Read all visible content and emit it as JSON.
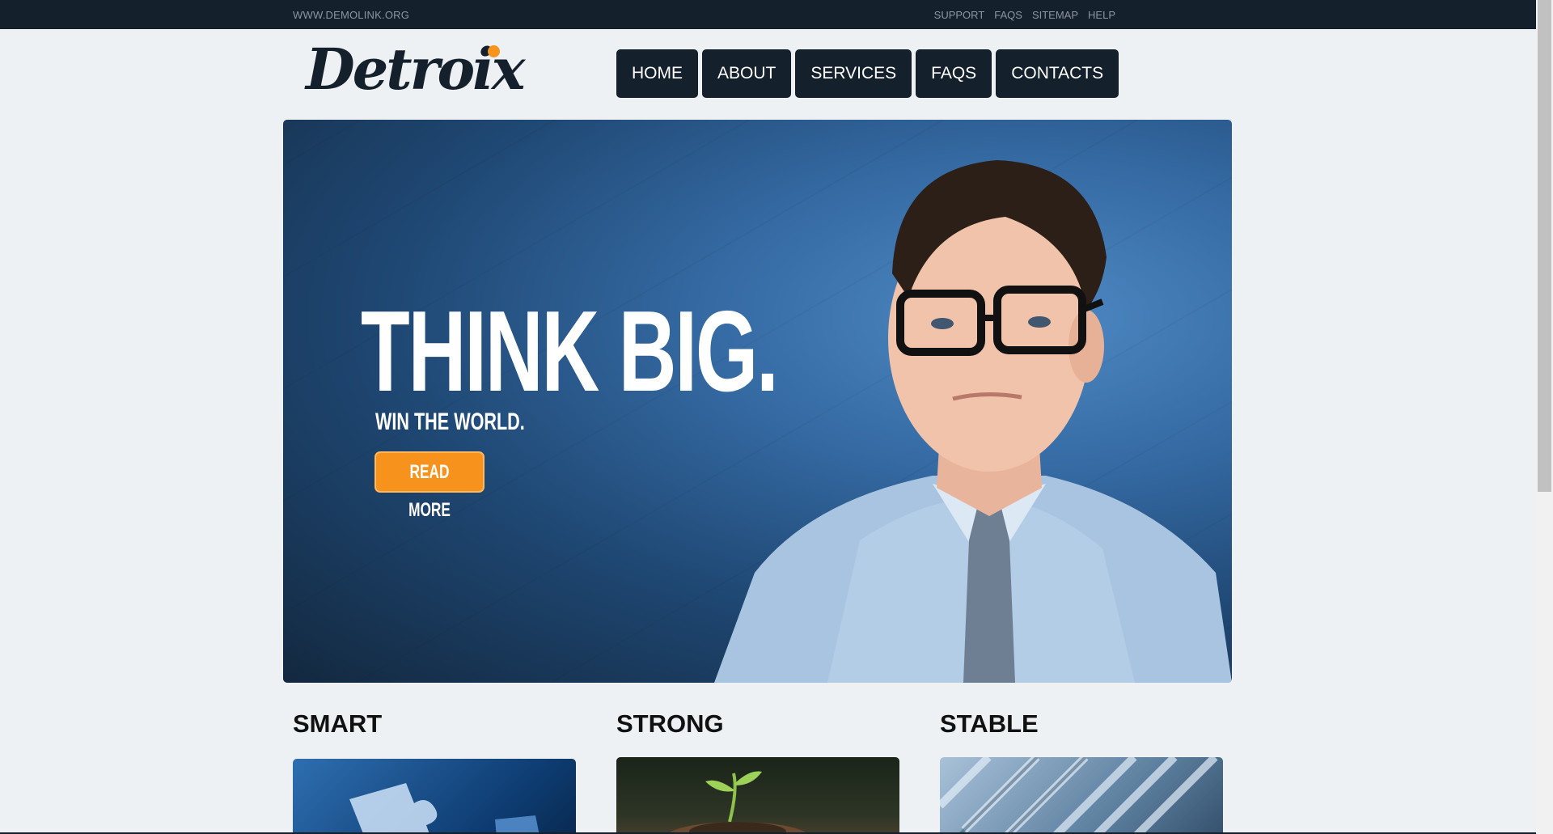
{
  "topbar": {
    "url": "WWW.DEMOLINK.ORG",
    "links": [
      "SUPPORT",
      "FAQS",
      "SITEMAP",
      "HELP"
    ]
  },
  "logo": {
    "text": "Detroix"
  },
  "nav": {
    "items": [
      "HOME",
      "ABOUT",
      "SERVICES",
      "FAQS",
      "CONTACTS"
    ]
  },
  "hero": {
    "headline": "THINK BIG.",
    "subhead": "WIN THE WORLD.",
    "cta": "READ MORE"
  },
  "features": [
    {
      "title": "SMART"
    },
    {
      "title": "STRONG"
    },
    {
      "title": "STABLE"
    }
  ],
  "colors": {
    "dark": "#15202d",
    "accent": "#f7941d",
    "background": "#eef1f3"
  }
}
